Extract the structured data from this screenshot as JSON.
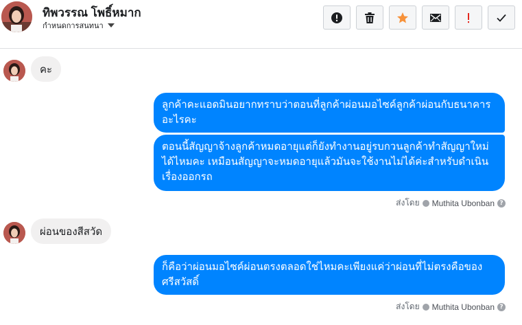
{
  "header": {
    "name": "ทิพวรรณ โพธิ์หมาก",
    "assign_label": "กำหนดการสนทนา"
  },
  "toolbar": {
    "buttons": [
      {
        "icon": "exclamation-circle-icon",
        "label": "Mark as spam"
      },
      {
        "icon": "trash-icon",
        "label": "Delete"
      },
      {
        "icon": "star-icon",
        "label": "Star",
        "color": "#f7923a"
      },
      {
        "icon": "envelope-icon",
        "label": "Mark as unread"
      },
      {
        "icon": "exclamation-icon",
        "label": "Follow up",
        "color": "#e4281e"
      },
      {
        "icon": "check-icon",
        "label": "Mark as done"
      }
    ]
  },
  "messages": [
    {
      "from": "customer",
      "text": "คะ"
    },
    {
      "from": "page",
      "text": "ลูกค้าคะแอดมินอยากทราบว่าตอนที่ลูกค้าผ่อนมอไซค์ลูกค้าผ่อนกับธนาคาร อะไรคะ"
    },
    {
      "from": "page",
      "text": "ตอนนี้สัญญาจ้างลูกค้าหมดอายุแต่ก็ยังทำงานอยู่รบกวนลูกค้าทำสัญญาใหม่ ได้ไหมคะ เหมือนสัญญาจะหมดอายุแล้วมันจะใช้งานไม่ได้ค่ะสำหรับดำเนิน เรื่องออกรถ"
    },
    {
      "from": "customer",
      "text": "ผ่อนของสีสวัด"
    },
    {
      "from": "page",
      "text": "ก็คือว่าผ่อนมอไซค์ผ่อนตรงตลอดใช่ไหมคะเพียงแค่ว่าผ่อนที่ไม่ตรงคือของ ศรีสวัสดิ์"
    }
  ],
  "sent_by": {
    "prefix": "ส่งโดย",
    "name": "Muthita Ubonban",
    "help": "?"
  },
  "colors": {
    "outgoing_bubble": "#0084ff",
    "incoming_bubble": "#f1f0f0",
    "star": "#f7923a",
    "alert": "#e4281e"
  }
}
